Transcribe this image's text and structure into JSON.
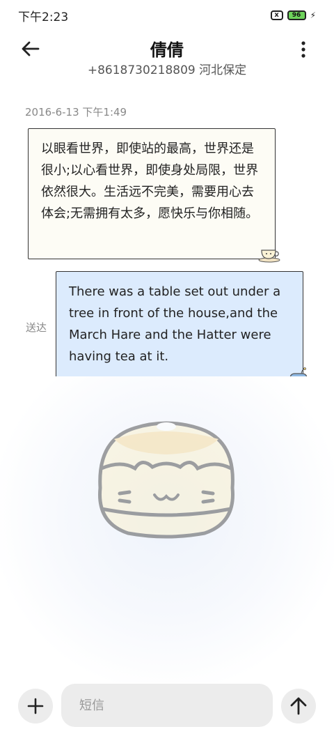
{
  "status_bar": {
    "time": "下午2:23",
    "sim_icon": "x",
    "battery": "96",
    "icons": [
      "sim-off-icon",
      "battery-icon",
      "charging-bolt-icon"
    ]
  },
  "header": {
    "contact_name": "倩倩",
    "contact_number": "+8618730218809 河北保定",
    "icons": [
      "back-arrow-icon",
      "more-vertical-icon"
    ]
  },
  "conversation": {
    "timestamp": "2016-6-13 下午1:49",
    "messages": [
      {
        "direction": "incoming",
        "text": "以眼看世界，即使站的最高，世界还是很小;以心看世界，即使身处局限，世界依然很大。生活远不完美，需要用心去体会;无需拥有太多，愿快乐与你相随。"
      },
      {
        "direction": "outgoing",
        "text": "There was a table set out under a tree in front of the house,and the March Hare and the Hatter were having tea at it.",
        "status": "送达"
      }
    ]
  },
  "composer": {
    "placeholder": "短信",
    "icons": [
      "plus-icon",
      "send-arrow-icon"
    ]
  },
  "colors": {
    "incoming_bubble": "#fdfcf5",
    "outgoing_bubble": "#dcebfd",
    "battery": "#6ed35b",
    "button_bg": "#ececec"
  }
}
